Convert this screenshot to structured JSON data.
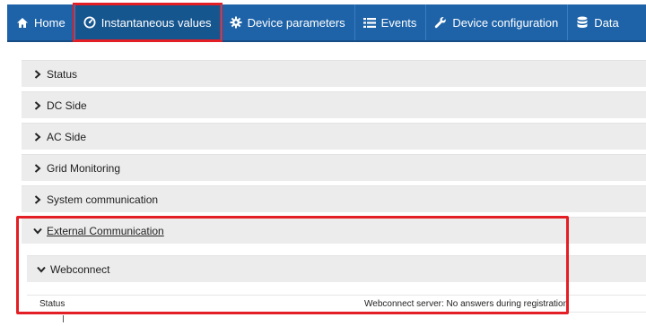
{
  "nav": {
    "items": [
      {
        "label": "Home",
        "icon": "home-icon"
      },
      {
        "label": "Instantaneous values",
        "icon": "gauge-icon",
        "active": true
      },
      {
        "label": "Device parameters",
        "icon": "gear-icon"
      },
      {
        "label": "Events",
        "icon": "list-icon"
      },
      {
        "label": "Device configuration",
        "icon": "wrench-icon"
      },
      {
        "label": "Data",
        "icon": "database-icon"
      }
    ]
  },
  "sections": [
    {
      "label": "Status",
      "expanded": false
    },
    {
      "label": "DC Side",
      "expanded": false
    },
    {
      "label": "AC Side",
      "expanded": false
    },
    {
      "label": "Grid Monitoring",
      "expanded": false
    },
    {
      "label": "System communication",
      "expanded": false
    },
    {
      "label": "External Communication",
      "expanded": true
    }
  ],
  "webconnect": {
    "label": "Webconnect",
    "status_key": "Status",
    "status_value": "Webconnect server: No answers during registration"
  },
  "colors": {
    "navbar": "#1e63a8",
    "highlight": "#e31e25",
    "panel": "#ececec"
  }
}
